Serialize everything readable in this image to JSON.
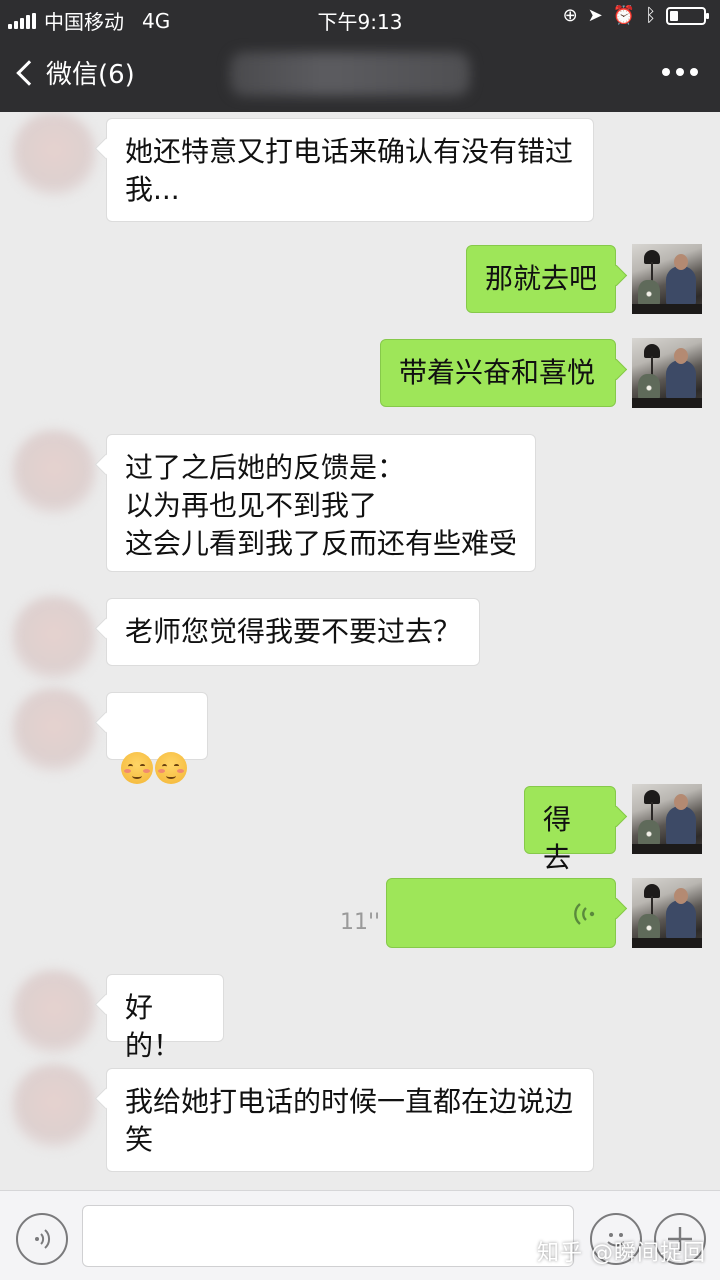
{
  "status_bar": {
    "carrier": "中国移动",
    "network": "4G",
    "time": "下午9:13",
    "battery_level": 0.25
  },
  "nav": {
    "back_label": "微信(6)",
    "more_icon": "more-dots-icon"
  },
  "messages": [
    {
      "side": "left",
      "text": "她还特意又打电话来确认有没有错过\n我..."
    },
    {
      "side": "right",
      "text": "那就去吧"
    },
    {
      "side": "right",
      "text": "带着兴奋和喜悦"
    },
    {
      "side": "left",
      "text": "过了之后她的反馈是：\n以为再也见不到我了\n这会儿看到我了反而还有些难受"
    },
    {
      "side": "left",
      "text": "老师您觉得我要不要过去？"
    },
    {
      "side": "left",
      "emoji": "smiling-face-emoji",
      "count": 2
    },
    {
      "side": "right",
      "text": "得去"
    },
    {
      "side": "right",
      "type": "voice",
      "duration": "11''"
    },
    {
      "side": "left",
      "text": "好的！"
    },
    {
      "side": "left",
      "text": "我给她打电话的时候一直都在边说边\n笑"
    }
  ],
  "input_bar": {
    "voice_icon": "voice-toggle-icon",
    "emoji_icon": "emoji-icon",
    "plus_icon": "plus-icon",
    "watermark": "知乎 @瞬间捉回"
  },
  "colors": {
    "header_bg": "#2e2e30",
    "chat_bg": "#ebebeb",
    "bubble_sent": "#9ee659",
    "bubble_received": "#ffffff"
  }
}
